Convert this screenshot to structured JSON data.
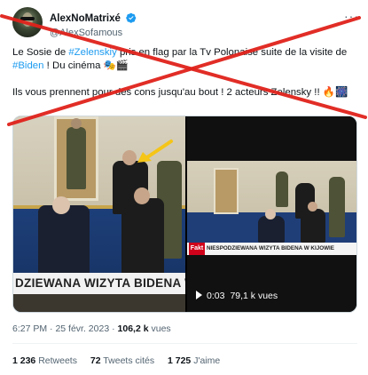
{
  "author": {
    "display_name": "AlexNoMatrixé",
    "handle": "@AlexSofamous",
    "avatar_icon": "avatar-photo",
    "verified_icon": "verified-badge-icon",
    "verified_color": "#1d9bf0"
  },
  "more_label": "···",
  "tweet": {
    "line1_pre": "Le Sosie de ",
    "hashtag1": "#Zelenskiy",
    "line1_mid": " pris en flag par la Tv Polonaise suite de la visite de ",
    "hashtag2": "#Biden",
    "line1_post": " ! Du cinéma 🎭🎬",
    "line2": "Ils vous prennent pour des cons jusqu'au bout ! 2 acteurs Zelensky !! 🔥🎆"
  },
  "media": {
    "left_caption": "DZIEWANA WIZYTA BIDENA W",
    "right_brand": "Fakt",
    "right_headline": "NIESPODZIEWANA WIZYTA BIDENA W KIJOWIE",
    "video_time": "0:03",
    "video_views": "79,1 k vues"
  },
  "meta": {
    "time": "6:27 PM",
    "sep": " · ",
    "date": "25 févr. 2023",
    "views_count": "106,2 k",
    "views_label": " vues"
  },
  "stats": {
    "retweets_count": "1 236",
    "retweets_label": " Retweets",
    "quotes_count": "72",
    "quotes_label": " Tweets cités",
    "likes_count": "1 725",
    "likes_label": " J'aime"
  },
  "colors": {
    "accent": "#1d9bf0",
    "cross": "#e0221b",
    "arrow": "#f5c518"
  }
}
